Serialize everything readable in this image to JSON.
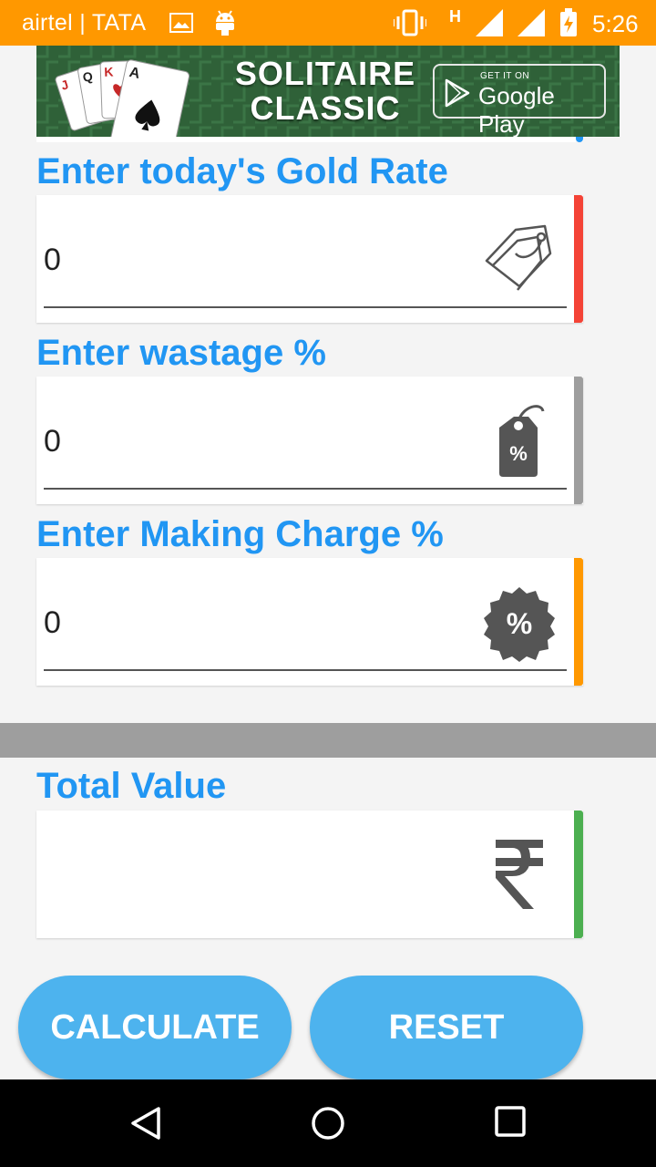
{
  "status_bar": {
    "carrier": "airtel | TATA",
    "network_type": "H",
    "time": "5:26",
    "background_color": "#FF9800",
    "icons": [
      "image-icon",
      "android-icon",
      "vibrate-icon",
      "signal-icon",
      "signal-icon",
      "battery-charging-icon"
    ]
  },
  "ad": {
    "title_line1": "SOLITAIRE",
    "title_line2": "CLASSIC",
    "store_prefix": "GET IT ON",
    "store_name": "Google Play"
  },
  "fields": [
    {
      "label": "Enter today's Gold Rate",
      "value": "0",
      "icon": "price-tag-icon",
      "accent_color": "#F44336"
    },
    {
      "label": "Enter wastage %",
      "value": "0",
      "icon": "percent-tag-icon",
      "accent_color": "#9E9E9E"
    },
    {
      "label": "Enter Making Charge %",
      "value": "0",
      "icon": "percent-badge-icon",
      "accent_color": "#FF9800"
    }
  ],
  "total": {
    "label": "Total Value",
    "value": "",
    "icon": "rupee-icon",
    "accent_color": "#4CAF50"
  },
  "buttons": {
    "calculate": "CALCULATE",
    "reset": "RESET",
    "color": "#4DB3EE"
  },
  "nav_bar": {
    "icons": [
      "back-icon",
      "home-icon",
      "recents-icon"
    ]
  },
  "theme": {
    "label_color": "#2196F3"
  }
}
